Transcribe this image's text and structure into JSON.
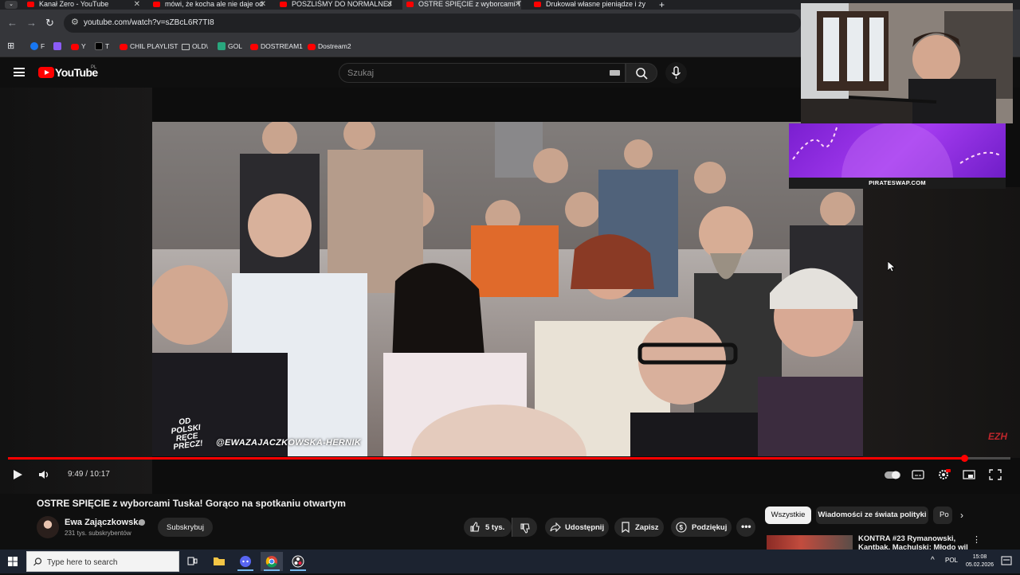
{
  "browser": {
    "tabs": [
      {
        "title": "Kanał Zero - YouTube",
        "active": false
      },
      {
        "title": "mówi, że kocha ale nie daje od",
        "active": false
      },
      {
        "title": "POSZLIŚMY DO NORMALNEJ P",
        "active": false
      },
      {
        "title": "OSTRE SPIĘCIE z wyborcami Tu",
        "active": true
      },
      {
        "title": "Drukował własne pieniądze i ży",
        "active": false
      }
    ],
    "url": "youtube.com/watch?v=sZBcL6R7TI8",
    "bookmarks": [
      {
        "label": "F",
        "color": "#1877f2"
      },
      {
        "label": "",
        "color": "#8b5cf6"
      },
      {
        "label": "Y",
        "color": "#ff0000"
      },
      {
        "label": "T",
        "color": "#000000"
      },
      {
        "label": "CHIL PLAYLIST",
        "color": "#ff0000"
      },
      {
        "label": "OLD\\",
        "color": "folder"
      },
      {
        "label": "GOL",
        "color": "#29a77e"
      },
      {
        "label": "DOSTREAM1",
        "color": "#ff0000"
      },
      {
        "label": "Dostream2",
        "color": "#ff0000"
      }
    ]
  },
  "youtube": {
    "logo_text": "YouTube",
    "country_code": "PL",
    "search_placeholder": "Szukaj",
    "accent_color": "#ff0000"
  },
  "player": {
    "video_handle_overlay": "@EWAZAJACZKOWSKA-HERNIK",
    "logo_overlay": "OD POLSKI RĘCE PRECZ!",
    "channel_badge": "EZH",
    "current_time": "9:49",
    "duration": "10:17",
    "time_display": "9:49 / 10:17",
    "progress_fraction": 0.954
  },
  "video": {
    "title": "OSTRE SPIĘCIE z wyborcami Tuska! Gorąco na spotkaniu otwartym",
    "channel_name": "Ewa Zajączkowska",
    "subscribers": "231 tys. subskrybentów",
    "subscribe_label": "Subskrybuj",
    "like_count": "5 tys.",
    "share_label": "Udostępnij",
    "save_label": "Zapisz",
    "thanks_label": "Podziękuj"
  },
  "sidebar": {
    "chips": [
      "Wszystkie",
      "Wiadomości ze świata polityki",
      "Po"
    ],
    "recommendation_title": "KONTRA #23 Rymanowski, Kantbak, Machulski: Młodo wil"
  },
  "overlay": {
    "promo_text": "PIRATESWAP.COM"
  },
  "taskbar": {
    "search_placeholder": "Type here to search",
    "language": "POL",
    "time": "15:08",
    "date": "05.02.2026"
  }
}
